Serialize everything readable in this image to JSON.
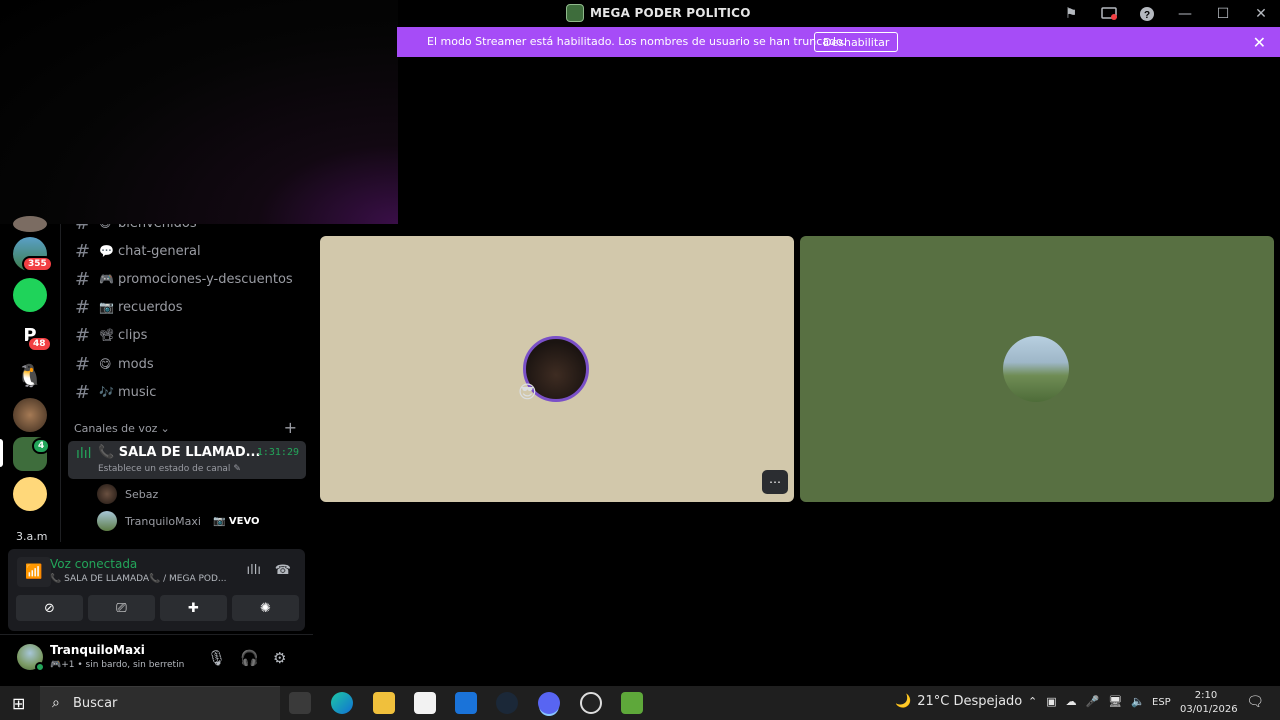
{
  "window": {
    "title": "MEGA PODER POLITICO"
  },
  "banner": {
    "text": "El modo Streamer está habilitado. Los nombres de usuario se han truncado.",
    "button": "Deshabilitar"
  },
  "rail": {
    "badges": [
      "355",
      "48",
      "4"
    ],
    "label": "3.a.m"
  },
  "channels": {
    "items": [
      {
        "emoji": "😄",
        "name": "bienvenidos"
      },
      {
        "emoji": "💬",
        "name": "chat-general"
      },
      {
        "emoji": "🎮",
        "name": "promociones-y-descuentos"
      },
      {
        "emoji": "📷",
        "name": "recuerdos"
      },
      {
        "emoji": "📽",
        "name": "clips"
      },
      {
        "emoji": "😋",
        "name": "mods"
      },
      {
        "emoji": "🎶",
        "name": "music"
      }
    ],
    "voice_category": "Canales de voz",
    "voice_room": {
      "name": "📞 SALA DE LLAMAD...",
      "time": "1:31:29",
      "status": "Establece un estado de canal"
    },
    "members": [
      {
        "name": "Sebaz",
        "tag": ""
      },
      {
        "name": "TranquiloMaxi",
        "tag": "📷 VEVO"
      }
    ]
  },
  "voice_panel": {
    "title": "Voz conectada",
    "subtitle": "📞 SALA DE LLAMADA📞 / MEGA POD..."
  },
  "user": {
    "name": "TranquiloMaxi",
    "status": "🎮+1 • sin bardo, sin berretin"
  },
  "taskbar": {
    "search_placeholder": "Buscar",
    "weather": "21°C  Despejado",
    "lang": "ESP",
    "time": "2:10",
    "date": "03/01/2026"
  },
  "colors": {
    "banner": "#a64cf7",
    "tile_a": "#d2c8ab",
    "tile_b": "#587042",
    "voice_green": "#23a55a"
  }
}
